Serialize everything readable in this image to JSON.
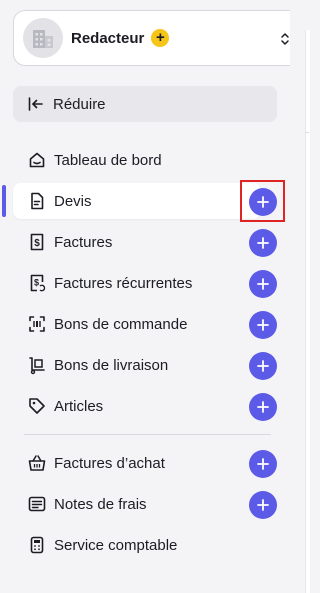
{
  "company": {
    "name": "Redacteur",
    "plan_badge": "+"
  },
  "collapse": {
    "label": "Réduire"
  },
  "nav": {
    "dashboard": "Tableau de bord",
    "quotes": "Devis",
    "invoices": "Factures",
    "recurring_invoices": "Factures récurrentes",
    "purchase_orders": "Bons de commande",
    "delivery_notes": "Bons de livraison",
    "items": "Articles",
    "purchase_invoices": "Factures d’achat",
    "expense_notes": "Notes de frais",
    "accounting_service": "Service comptable"
  },
  "active_item": "Devis",
  "colors": {
    "accent": "#5b5be8",
    "highlight": "#e02424",
    "badge": "#f5c518"
  },
  "icons": {
    "company": "building-icon",
    "switch": "chevron-up-down-icon",
    "collapse": "collapse-left-icon",
    "add": "plus-icon"
  }
}
